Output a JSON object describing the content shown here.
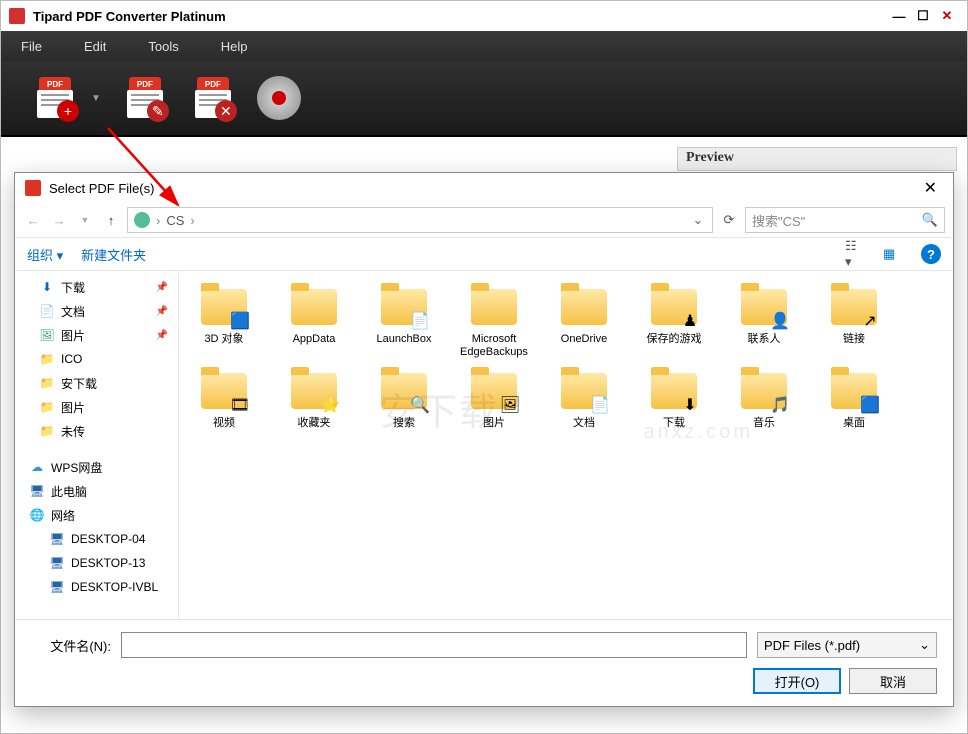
{
  "app": {
    "title": "Tipard PDF Converter Platinum",
    "pdf_badge": "PDF"
  },
  "menu": {
    "file": "File",
    "edit": "Edit",
    "tools": "Tools",
    "help": "Help"
  },
  "preview": {
    "title": "Preview"
  },
  "dialog": {
    "title": "Select PDF File(s)",
    "crumb": "CS",
    "search_placeholder": "搜索\"CS\"",
    "organize": "组织 ▾",
    "new_folder": "新建文件夹",
    "filename_label": "文件名(N):",
    "filename_value": "",
    "filetype": "PDF Files (*.pdf)",
    "open_btn": "打开(O)",
    "cancel_btn": "取消"
  },
  "side": [
    {
      "label": "下载",
      "icon": "⬇",
      "color": "#0066cc",
      "pin": true
    },
    {
      "label": "文档",
      "icon": "📄",
      "color": "#555",
      "pin": true
    },
    {
      "label": "图片",
      "icon": "🖼",
      "color": "#3a7",
      "pin": true
    },
    {
      "label": "ICO",
      "icon": "📁",
      "color": "#e6b800",
      "pin": false
    },
    {
      "label": "安下载",
      "icon": "📁",
      "color": "#e6b800",
      "pin": false
    },
    {
      "label": "图片",
      "icon": "📁",
      "color": "#e6b800",
      "pin": false
    },
    {
      "label": "未传",
      "icon": "📁",
      "color": "#e6b800",
      "pin": false
    }
  ],
  "side2": [
    {
      "label": "WPS网盘",
      "icon": "☁",
      "color": "#39c",
      "lvl": 0
    },
    {
      "label": "此电脑",
      "icon": "🖥",
      "color": "#2266aa",
      "lvl": 0
    },
    {
      "label": "网络",
      "icon": "🌐",
      "color": "#2266aa",
      "lvl": 0
    },
    {
      "label": "DESKTOP-04",
      "icon": "🖥",
      "color": "#2266aa",
      "lvl": 2
    },
    {
      "label": "DESKTOP-13",
      "icon": "🖥",
      "color": "#2266aa",
      "lvl": 2
    },
    {
      "label": "DESKTOP-IVBL",
      "icon": "🖥",
      "color": "#2266aa",
      "lvl": 2
    }
  ],
  "folders": [
    {
      "label": "3D 对象",
      "overlay": "🟦"
    },
    {
      "label": "AppData",
      "overlay": ""
    },
    {
      "label": "LaunchBox",
      "overlay": "📄"
    },
    {
      "label": "Microsoft EdgeBackups",
      "overlay": ""
    },
    {
      "label": "OneDrive",
      "overlay": ""
    },
    {
      "label": "保存的游戏",
      "overlay": "♟"
    },
    {
      "label": "联系人",
      "overlay": "👤"
    },
    {
      "label": "链接",
      "overlay": "↗"
    },
    {
      "label": "视频",
      "overlay": "🎞"
    },
    {
      "label": "收藏夹",
      "overlay": "⭐"
    },
    {
      "label": "搜索",
      "overlay": "🔍"
    },
    {
      "label": "图片",
      "overlay": "🖼"
    },
    {
      "label": "文档",
      "overlay": "📄"
    },
    {
      "label": "下载",
      "overlay": "⬇"
    },
    {
      "label": "音乐",
      "overlay": "🎵"
    },
    {
      "label": "桌面",
      "overlay": "🟦"
    }
  ]
}
